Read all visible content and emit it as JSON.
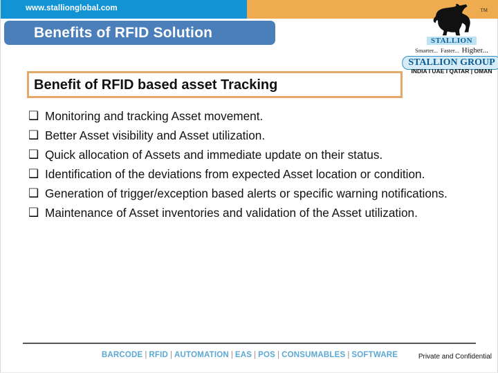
{
  "header": {
    "site_url": "www.stallionglobal.com",
    "colors": {
      "blue": "#1193d4",
      "orange": "#efab50"
    }
  },
  "logo": {
    "trademark": "TM",
    "horse_icon": "horse-silhouette-icon",
    "brand": "STALLION",
    "tagline": [
      "Smarter...",
      "Faster...",
      "Higher..."
    ],
    "group_name": "STALLION GROUP",
    "countries": "INDIA  I  UAE  I  QATAR  |  OMAN",
    "accent": "#0b5c92"
  },
  "title": {
    "text": "Benefits of RFID Solution",
    "bar_color": "#4a7fba"
  },
  "subtitle": {
    "text": "Benefit of RFID based asset Tracking",
    "border_color": "#e3a86a"
  },
  "bullets": {
    "marker": "❑",
    "items": [
      "Monitoring and tracking Asset movement.",
      "Better Asset visibility and Asset utilization.",
      "Quick allocation of Assets and immediate update on their status.",
      "Identification of the deviations from expected Asset location or condition.",
      "Generation of trigger/exception based alerts or specific warning notifications.",
      "Maintenance of Asset inventories and validation of the Asset utilization."
    ]
  },
  "footer": {
    "links": [
      "BARCODE",
      "RFID",
      "AUTOMATION",
      "EAS",
      "POS",
      "CONSUMABLES",
      "SOFTWARE"
    ],
    "separator": "|",
    "confidential": "Private and Confidential",
    "link_color": "#5ba8d4"
  }
}
